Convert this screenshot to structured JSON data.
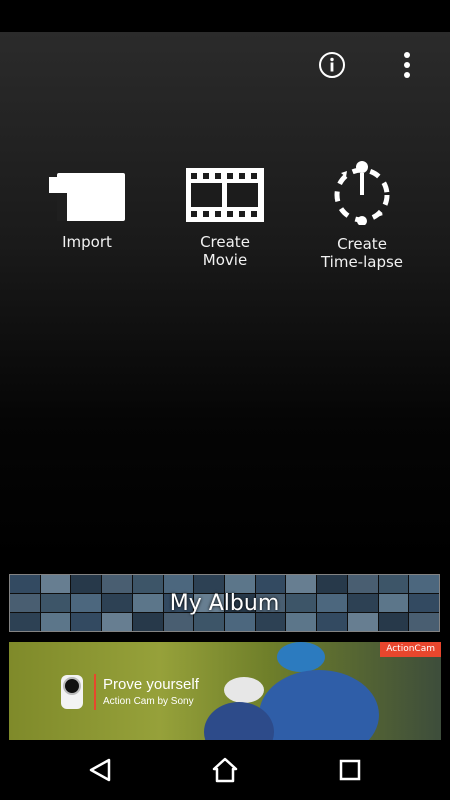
{
  "toolbar": {
    "info_icon": "info-icon",
    "more_icon": "more-vert-icon"
  },
  "actions": [
    {
      "label": "Import",
      "icon": "camera-import-icon"
    },
    {
      "label": "Create\nMovie",
      "icon": "film-strip-icon"
    },
    {
      "label": "Create\nTime-lapse",
      "icon": "time-lapse-icon"
    }
  ],
  "album": {
    "label": "My Album"
  },
  "ad": {
    "badge": "ActionCam",
    "title": "Prove yourself",
    "subtitle": "Action Cam by Sony",
    "accent": "#e8462d"
  },
  "nav": {
    "back": "back-icon",
    "home": "home-icon",
    "recents": "recents-icon"
  }
}
